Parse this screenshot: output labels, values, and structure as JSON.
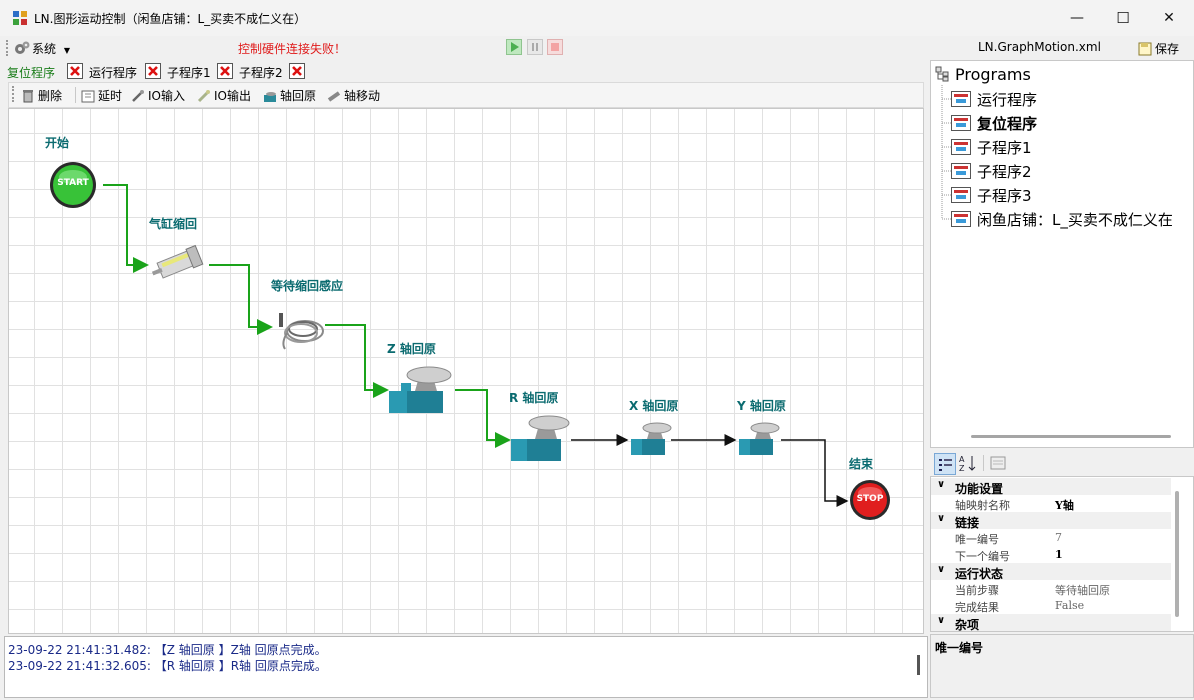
{
  "window": {
    "title": "LN.图形运动控制（闲鱼店铺：L_买卖不成仁义在）",
    "minimize": "—",
    "maximize": "☐",
    "close": "✕"
  },
  "menubar": {
    "system_label": "系统",
    "error_text": "控制硬件连接失败！",
    "file_name": "LN.GraphMotion.xml",
    "save_label": "保存",
    "error_color": "#e01b1b"
  },
  "tabs": [
    {
      "label": "复位程序",
      "active": true
    },
    {
      "label": "运行程序"
    },
    {
      "label": "子程序1"
    },
    {
      "label": "子程序2"
    }
  ],
  "toolbar": {
    "delete": "删除",
    "delay": "延时",
    "io_in": "IO输入",
    "io_out": "IO输出",
    "axis_home": "轴回原",
    "axis_move": "轴移动"
  },
  "flow": {
    "start_label": "开始",
    "start_button": "START",
    "node1": "气缸缩回",
    "node2": "等待缩回感应",
    "node3": "Z 轴回原",
    "node4": "R 轴回原",
    "node5": "X 轴回原",
    "node6": "Y 轴回原",
    "end_label": "结束",
    "end_button": "STOP",
    "active_line_color": "#1aa31a",
    "line_color": "#111111"
  },
  "tree": {
    "root": "Programs",
    "items": [
      "运行程序",
      "复位程序",
      "子程序1",
      "子程序2",
      "子程序3",
      "闲鱼店铺：L_买卖不成仁义在"
    ],
    "bold_item": "复位程序"
  },
  "propgrid": {
    "cat1": "功能设置",
    "p1_name": "轴映射名称",
    "p1_value": "Y轴",
    "cat2": "链接",
    "p2_name": "唯一编号",
    "p2_value": "7",
    "p3_name": "下一个编号",
    "p3_value": "1",
    "cat3": "运行状态",
    "p4_name": "当前步骤",
    "p4_value": "等待轴回原",
    "p5_name": "完成结果",
    "p5_value": "False",
    "cat4": "杂项",
    "description_title": "唯一编号"
  },
  "log": [
    "23-09-22 21:41:31.482: 【Z 轴回原 】Z轴 回原点完成。",
    "23-09-22 21:41:32.605: 【R 轴回原 】R轴 回原点完成。"
  ]
}
